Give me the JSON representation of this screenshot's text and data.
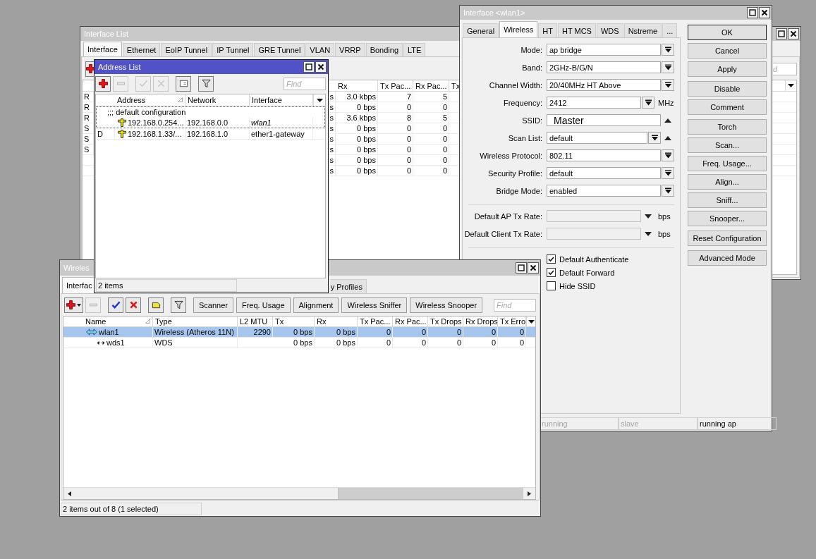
{
  "interface_list_window": {
    "title": "Interface List",
    "active": false,
    "tabs": [
      {
        "label": "Interface",
        "selected": true
      },
      {
        "label": "Ethernet",
        "selected": false
      },
      {
        "label": "EoIP Tunnel",
        "selected": false
      },
      {
        "label": "IP Tunnel",
        "selected": false
      },
      {
        "label": "GRE Tunnel",
        "selected": false
      },
      {
        "label": "VLAN",
        "selected": false
      },
      {
        "label": "VRRP",
        "selected": false
      },
      {
        "label": "Bonding",
        "selected": false
      },
      {
        "label": "LTE",
        "selected": false
      }
    ],
    "toolbar": [
      {
        "kind": "add",
        "disabled": false
      }
    ],
    "find": {
      "placeholder": "d"
    },
    "columns": [
      "Rx",
      "Tx Pac...",
      "Rx Pac...",
      "Tx"
    ],
    "rows": [
      {
        "flag": "R",
        "column_2": "s",
        "rx": "3.0 kbps",
        "tx_packets": "7",
        "rx_packets": "5"
      },
      {
        "flag": "R",
        "column_2": "s",
        "rx": "0 bps",
        "tx_packets": "0",
        "rx_packets": "0"
      },
      {
        "flag": "R",
        "column_2": "s",
        "rx": "3.6 kbps",
        "tx_packets": "8",
        "rx_packets": "5"
      },
      {
        "flag": "S",
        "column_2": "s",
        "rx": "0 bps",
        "tx_packets": "0",
        "rx_packets": "0"
      },
      {
        "flag": "S",
        "column_2": "s",
        "rx": "0 bps",
        "tx_packets": "0",
        "rx_packets": "0"
      },
      {
        "flag": "S",
        "column_2": "s",
        "rx": "0 bps",
        "tx_packets": "0",
        "rx_packets": "0"
      },
      {
        "column_2": "s",
        "rx": "0 bps",
        "tx_packets": "0",
        "rx_packets": "0"
      },
      {
        "column_2": "s",
        "rx": "0 bps",
        "tx_packets": "0",
        "rx_packets": "0"
      }
    ]
  },
  "address_list_window": {
    "title": "Address List",
    "active": true,
    "toolbar": [
      {
        "kind": "add",
        "disabled": false,
        "menu": false
      },
      {
        "kind": "remove",
        "disabled": true,
        "menu": false
      },
      {
        "kind": "enable",
        "disabled": true,
        "menu": false
      },
      {
        "kind": "disable",
        "disabled": true,
        "menu": false
      },
      {
        "kind": "note",
        "disabled": false,
        "menu": false
      },
      {
        "kind": "filter",
        "disabled": false,
        "menu": false
      }
    ],
    "find": {
      "placeholder": "Find"
    },
    "columns": [
      {
        "label": "Address",
        "sorted": true
      },
      {
        "label": "Network",
        "sorted": false
      },
      {
        "label": "Interface",
        "sorted": false
      }
    ],
    "rows": [
      {
        "comment": ";;; default configuration",
        "address": "192.168.0.254...",
        "network": "192.168.0.0",
        "interface": "wlan1",
        "interface_slave": true,
        "focused": true
      },
      {
        "flag": "D",
        "address": "192.168.1.33/...",
        "network": "192.168.1.0",
        "interface": "ether1-gateway",
        "interface_slave": false,
        "focused": false
      }
    ],
    "status": "2 items"
  },
  "wlan1_window": {
    "title": "Interface <wlan1>",
    "active": false,
    "tabs": [
      {
        "label": "General",
        "selected": false
      },
      {
        "label": "Wireless",
        "selected": true
      },
      {
        "label": "HT",
        "selected": false
      },
      {
        "label": "HT MCS",
        "selected": false
      },
      {
        "label": "WDS",
        "selected": false
      },
      {
        "label": "Nstreme",
        "selected": false
      },
      {
        "label": "...",
        "selected": false
      }
    ],
    "fields": [
      {
        "label": "Mode:",
        "value": "ap bridge",
        "kind": "dropdown",
        "collapsible": false,
        "disabled": false
      },
      {
        "label": "Band:",
        "value": "2GHz-B/G/N",
        "kind": "dropdown",
        "collapsible": false,
        "disabled": false
      },
      {
        "label": "Channel Width:",
        "value": "20/40MHz HT Above",
        "kind": "dropdown",
        "collapsible": false,
        "disabled": false
      },
      {
        "label": "Frequency:",
        "value": "2412",
        "kind": "dropdown",
        "unit": "MHz",
        "collapsible": false,
        "disabled": false
      },
      {
        "label": "SSID:",
        "value": "Master",
        "kind": "text",
        "collapsible": true,
        "disabled": false
      },
      {
        "label": "Scan List:",
        "value": "default",
        "kind": "dropdown",
        "collapsible": true,
        "disabled": false
      },
      {
        "label": "Wireless Protocol:",
        "value": "802.11",
        "kind": "dropdown",
        "collapsible": false,
        "disabled": false
      },
      {
        "label": "Security Profile:",
        "value": "default",
        "kind": "dropdown",
        "collapsible": false,
        "disabled": false
      },
      {
        "label": "Bridge Mode:",
        "value": "enabled",
        "kind": "dropdown",
        "collapsible": false,
        "disabled": false
      }
    ],
    "rate_fields": [
      {
        "label": "Default AP Tx Rate:",
        "kind": "combo",
        "unit": "bps",
        "collapsible": false,
        "disabled": true
      },
      {
        "label": "Default Client Tx Rate:",
        "kind": "combo",
        "unit": "bps",
        "collapsible": false,
        "disabled": true
      }
    ],
    "checkboxes": [
      {
        "label": "Default Authenticate",
        "checked": true
      },
      {
        "label": "Default Forward",
        "checked": true
      },
      {
        "label": "Hide SSID",
        "checked": false
      }
    ],
    "buttons": [
      [
        {
          "label": "OK",
          "default": true
        },
        {
          "label": "Cancel",
          "default": false
        },
        {
          "label": "Apply",
          "default": false
        }
      ],
      [
        {
          "label": "Disable",
          "default": false
        },
        {
          "label": "Comment",
          "default": false
        }
      ],
      [
        {
          "label": "Torch",
          "default": false
        },
        {
          "label": "Scan...",
          "default": false
        },
        {
          "label": "Freq. Usage...",
          "default": false
        },
        {
          "label": "Align...",
          "default": false
        },
        {
          "label": "Sniff...",
          "default": false
        },
        {
          "label": "Snooper...",
          "default": false
        }
      ],
      [
        {
          "label": "Reset Configuration",
          "default": false
        }
      ],
      [
        {
          "label": "Advanced Mode",
          "default": false
        }
      ]
    ],
    "status": [
      {
        "text": "running",
        "active": false
      },
      {
        "text": "slave",
        "active": false
      },
      {
        "text": "running ap",
        "active": true
      }
    ]
  },
  "wireless_window": {
    "title": "Wireles",
    "active": false,
    "tabs": [
      {
        "label": "Interfac",
        "selected": true
      },
      {
        "label": "y Profiles",
        "selected": false
      }
    ],
    "toolbar": [
      {
        "kind": "add",
        "disabled": false,
        "menu": true
      },
      {
        "kind": "remove",
        "disabled": true,
        "menu": false
      },
      {
        "kind": "enable",
        "disabled": false,
        "menu": false
      },
      {
        "kind": "disable",
        "disabled": false,
        "menu": false
      },
      {
        "kind": "comment",
        "disabled": false,
        "menu": false
      },
      {
        "kind": "filter",
        "disabled": false,
        "menu": false
      }
    ],
    "tool_buttons": [
      "Scanner",
      "Freq. Usage",
      "Alignment",
      "Wireless Sniffer",
      "Wireless Snooper"
    ],
    "find": {
      "placeholder": "Find"
    },
    "columns": [
      {
        "label": "Name",
        "sorted": true
      },
      {
        "label": "Type",
        "sorted": false
      },
      {
        "label": "L2 MTU",
        "sorted": false
      },
      {
        "label": "Tx",
        "sorted": false
      },
      {
        "label": "Rx",
        "sorted": false
      },
      {
        "label": "Tx Pac...",
        "sorted": false
      },
      {
        "label": "Rx Pac...",
        "sorted": false
      },
      {
        "label": "Tx Drops",
        "sorted": false
      },
      {
        "label": "Rx Drops",
        "sorted": false
      },
      {
        "label": "Tx Erro",
        "sorted": false
      }
    ],
    "rows": [
      {
        "kind": "wireless",
        "name": "wlan1",
        "type": "Wireless (Atheros 11N)",
        "l2_mtu": "2290",
        "tx": "0 bps",
        "rx": "0 bps",
        "tx_packets": "0",
        "rx_packets": "0",
        "tx_drops": "0",
        "rx_drops": "0",
        "tx_errors": "0",
        "selected": true,
        "children": [
          {
            "kind": "wds",
            "name": "wds1",
            "type": "WDS",
            "tx": "0 bps",
            "rx": "0 bps",
            "tx_packets": "0",
            "rx_packets": "0",
            "tx_drops": "0",
            "rx_drops": "0",
            "tx_errors": "0",
            "selected": false
          }
        ]
      }
    ],
    "status": "2 items out of 8 (1 selected)"
  }
}
